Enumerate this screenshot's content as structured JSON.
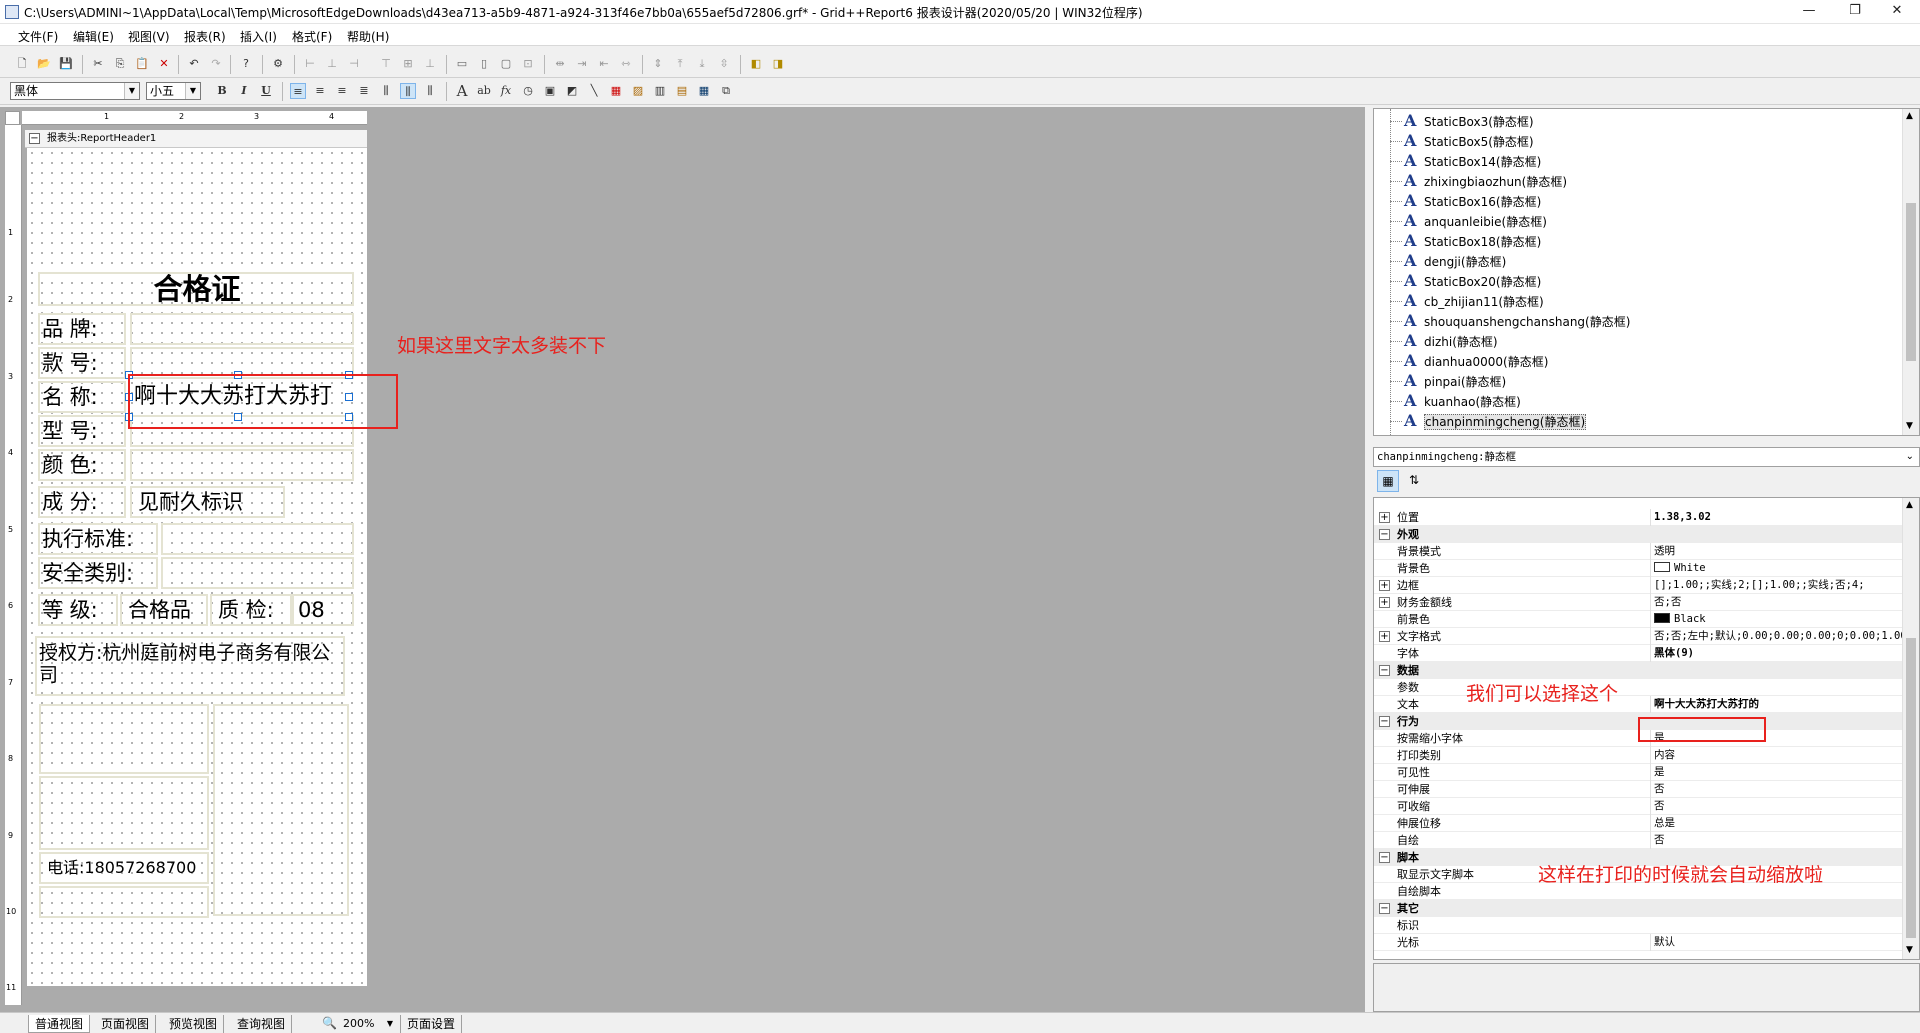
{
  "window": {
    "title": "C:\\Users\\ADMINI~1\\AppData\\Local\\Temp\\MicrosoftEdgeDownloads\\d43ea713-a5b9-4871-a924-313f46e7bb0a\\655aef5d72806.grf* - Grid++Report6 报表设计器(2020/05/20 | WIN32位程序)",
    "minimize": "—",
    "maximize": "❐",
    "close": "✕"
  },
  "menu": [
    "文件(F)",
    "编辑(E)",
    "视图(V)",
    "报表(R)",
    "插入(I)",
    "格式(F)",
    "帮助(H)"
  ],
  "format_toolbar": {
    "font_name": "黑体",
    "font_size": "小五",
    "bold": "B",
    "italic": "I",
    "underline": "U"
  },
  "ruler": {
    "marks": [
      "1",
      "2",
      "3",
      "4"
    ],
    "left_marks": [
      "1",
      "2",
      "3",
      "4",
      "5",
      "6",
      "7",
      "8",
      "9",
      "10",
      "11"
    ]
  },
  "band_header": "报表头:ReportHeader1",
  "report": {
    "title": "合格证",
    "labels": {
      "brand": "品 牌:",
      "style": "款 号:",
      "name": "名 称:",
      "model": "型 号:",
      "color": "颜 色:",
      "composition": "成 分:",
      "standard": "执行标准:",
      "safety": "安全类别:",
      "grade": "等 级:",
      "inspect": "质 检:"
    },
    "values": {
      "name": "啊十大大苏打大苏打",
      "composition": "见耐久标识",
      "grade": "合格品",
      "inspect": "08"
    },
    "authorizer": "授权方:杭州庭前树电子商务有限公司",
    "phone": "电话:18057268700"
  },
  "annotations": {
    "overflow_note": "如果这里文字太多装不下",
    "select_note": "我们可以选择这个",
    "result_note": "这样在打印的时候就会自动缩放啦"
  },
  "tree": {
    "items": [
      "StaticBox3(静态框)",
      "StaticBox5(静态框)",
      "StaticBox14(静态框)",
      "zhixingbiaozhun(静态框)",
      "StaticBox16(静态框)",
      "anquanleibie(静态框)",
      "StaticBox18(静态框)",
      "dengji(静态框)",
      "StaticBox20(静态框)",
      "cb_zhijian11(静态框)",
      "shouquanshengchanshang(静态框)",
      "dizhi(静态框)",
      "dianhua0000(静态框)",
      "pinpai(静态框)",
      "kuanhao(静态框)",
      "chanpinmingcheng(静态框)"
    ],
    "selected_index": 15
  },
  "properties": {
    "object": "chanpinmingcheng:静态框",
    "rows": [
      {
        "type": "prop",
        "expand": "+",
        "name": "位置",
        "value": "1.38,3.02"
      },
      {
        "type": "cat",
        "expand": "−",
        "name": "外观",
        "value": ""
      },
      {
        "type": "prop",
        "expand": "",
        "name": "背景模式",
        "value": "透明"
      },
      {
        "type": "prop",
        "expand": "",
        "name": "背景色",
        "value": "White",
        "swatch": "#ffffff"
      },
      {
        "type": "prop",
        "expand": "+",
        "name": "边框",
        "value": "[];1.00;;实线;2;[];1.00;;实线;否;4;"
      },
      {
        "type": "prop",
        "expand": "+",
        "name": "财务金额线",
        "value": "否;否"
      },
      {
        "type": "prop",
        "expand": "",
        "name": "前景色",
        "value": "Black",
        "swatch": "#000000"
      },
      {
        "type": "prop",
        "expand": "+",
        "name": "文字格式",
        "value": "否;否;左中;默认;0.00;0.00;0.00;0;0.00;1.00"
      },
      {
        "type": "prop",
        "expand": "",
        "name": "字体",
        "value": "黑体(9)"
      },
      {
        "type": "cat",
        "expand": "−",
        "name": "数据",
        "value": ""
      },
      {
        "type": "prop",
        "expand": "",
        "name": "参数",
        "value": ""
      },
      {
        "type": "prop",
        "expand": "",
        "name": "文本",
        "value": "啊十大大苏打大苏打的"
      },
      {
        "type": "cat",
        "expand": "−",
        "name": "行为",
        "value": ""
      },
      {
        "type": "prop",
        "expand": "",
        "name": "按需缩小字体",
        "value": "是"
      },
      {
        "type": "prop",
        "expand": "",
        "name": "打印类别",
        "value": "内容"
      },
      {
        "type": "prop",
        "expand": "",
        "name": "可见性",
        "value": "是"
      },
      {
        "type": "prop",
        "expand": "",
        "name": "可伸展",
        "value": "否"
      },
      {
        "type": "prop",
        "expand": "",
        "name": "可收缩",
        "value": "否"
      },
      {
        "type": "prop",
        "expand": "",
        "name": "伸展位移",
        "value": "总是"
      },
      {
        "type": "prop",
        "expand": "",
        "name": "自绘",
        "value": "否"
      },
      {
        "type": "cat",
        "expand": "−",
        "name": "脚本",
        "value": ""
      },
      {
        "type": "prop",
        "expand": "",
        "name": "取显示文字脚本",
        "value": ""
      },
      {
        "type": "prop",
        "expand": "",
        "name": "自绘脚本",
        "value": ""
      },
      {
        "type": "cat",
        "expand": "−",
        "name": "其它",
        "value": ""
      },
      {
        "type": "prop",
        "expand": "",
        "name": "标识",
        "value": ""
      },
      {
        "type": "prop",
        "expand": "",
        "name": "光标",
        "value": "默认"
      }
    ]
  },
  "status_tabs": [
    "普通视图",
    "页面视图",
    "预览视图",
    "查询视图"
  ],
  "zoom": "200%",
  "page_setup": "页面设置",
  "colors": {
    "accent_red": "#e8211d",
    "selection_blue": "#1a6fd1",
    "canvas_gray": "#ababab"
  }
}
